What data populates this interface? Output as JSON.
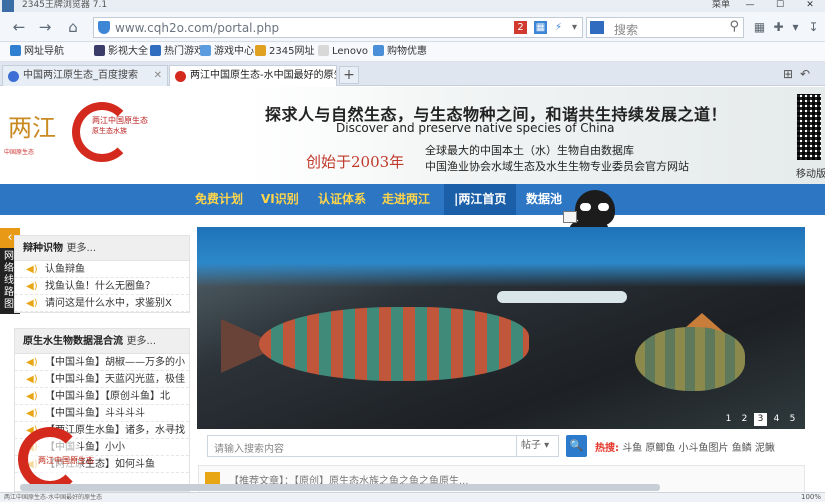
{
  "window": {
    "title": "2345王牌浏览器 7.1",
    "top_right_label": "菜单",
    "controls": [
      "—",
      "☐",
      "✕"
    ]
  },
  "nav": {
    "url": "www.cqh2o.com/portal.php",
    "search_placeholder": "搜索"
  },
  "bookmarks": [
    {
      "label": "网址导航",
      "color": "#2f80d1"
    },
    {
      "label": "影视大全",
      "color": "#3c3c6a"
    },
    {
      "label": "热门游戏",
      "color": "#2f6bbf"
    },
    {
      "label": "游戏中心",
      "color": "#5a9be0"
    },
    {
      "label": "2345网址",
      "color": "#e0a020"
    },
    {
      "label": "Lenovo",
      "color": "#d8d8d8"
    },
    {
      "label": "购物优惠",
      "color": "#4a8fd8"
    }
  ],
  "tabs": [
    {
      "label": "中国两江原生态_百度搜索",
      "active": false,
      "color": "#3b6fd6"
    },
    {
      "label": "两江中国原生态-水中国最好的原生态",
      "active": true,
      "color": "#d42a1e"
    }
  ],
  "header": {
    "logo_seal": "两江",
    "logo_sub": "中国原生态",
    "logo_b_title": "两江中国原生态",
    "logo_b_sub": "原生态水族",
    "slogan_cn": "探求人与自然生态，与生态物种之间，和谐共生持续发展之道！",
    "slogan_en": "Discover and preserve native species of China",
    "calligraphy": "创始于2003年",
    "db_line1": "全球最大的中国本土（水）生物自由数据库",
    "db_line2": "中国渔业协会水域生态及水生生物专业委员会官方网站",
    "qr_label": "移动版"
  },
  "menu": [
    {
      "label": "免费计划",
      "style": "yellow"
    },
    {
      "label": "VI识别",
      "style": "yellow"
    },
    {
      "label": "认证体系",
      "style": "yellow"
    },
    {
      "label": "走进两江",
      "style": "yellow"
    },
    {
      "label": "|两江首页",
      "style": "active"
    },
    {
      "label": "数据池",
      "style": "white"
    }
  ],
  "side_tab": {
    "arrow": "‹",
    "text": "网络线路图"
  },
  "panel1": {
    "title": "辩种识物",
    "more": "更多...",
    "items": [
      "认鱼辩鱼",
      "找鱼认鱼！什么无圈鱼？",
      "请问这是什么水中，求鉴别X"
    ]
  },
  "panel2": {
    "title": "原生水生物数据混合流",
    "more": "更多...",
    "items": [
      "【中国斗鱼】胡椒——万多的小",
      "【中国斗鱼】天蓝闪光蓝，极佳",
      "【中国斗鱼】【原创斗鱼】北",
      "【中国斗鱼】斗斗斗斗",
      "【两江原生水鱼】诸多，水寻找",
      "【中国斗鱼】小小",
      "【两江原生态】如何斗鱼"
    ]
  },
  "slider": {
    "pages": [
      "1",
      "2",
      "3",
      "4",
      "5"
    ],
    "active_page": 3
  },
  "site_search": {
    "placeholder": "请输入搜索内容",
    "select": "帖子",
    "button": "🔍",
    "hot_label": "热搜:",
    "hot_terms": "斗鱼 原鲫鱼 小斗鱼图片 鱼鳞 泥鳅"
  },
  "news": {
    "text": "【推荐文章】：【原创】原生态水族之鱼之鱼之鱼原生..."
  },
  "floater_text": "两江中国原生态",
  "status": {
    "left": "两江中国原生态-水中国最好的原生态",
    "right": "100%"
  }
}
